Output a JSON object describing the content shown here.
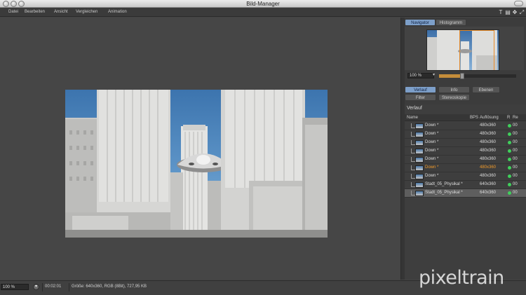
{
  "window": {
    "title": "Bild-Manager"
  },
  "menu": [
    "Datei",
    "Bearbeiten",
    "Ansicht",
    "Vergleichen",
    "Animation"
  ],
  "toolbar_icons": [
    "text-icon",
    "layout-icon",
    "move-icon",
    "expand-icon"
  ],
  "navigator": {
    "tabs": [
      "Navigator",
      "Histogramm"
    ],
    "zoom": "100 %",
    "zoom_fraction": 0.3
  },
  "panel_tabs": {
    "row1": [
      "Verlauf",
      "Info",
      "Ebenen"
    ],
    "row2": [
      "Filter",
      "Stereoskopie"
    ]
  },
  "history": {
    "section_title": "Verlauf",
    "columns": {
      "name": "Name",
      "bps": "BPS",
      "resolution": "Auflösung",
      "r": "R",
      "re": "Re"
    },
    "rows": [
      {
        "name": "Down *",
        "res": "480x360",
        "extra": "00"
      },
      {
        "name": "Down *",
        "res": "480x360",
        "extra": "00"
      },
      {
        "name": "Down *",
        "res": "480x360",
        "extra": "00"
      },
      {
        "name": "Down *",
        "res": "480x360",
        "extra": "00"
      },
      {
        "name": "Down *",
        "res": "480x360",
        "extra": "00"
      },
      {
        "name": "Down *",
        "res": "480x360",
        "extra": "00"
      },
      {
        "name": "Down *",
        "res": "480x360",
        "extra": "00"
      },
      {
        "name": "Stadt_05_Physikal *",
        "res": "640x360",
        "extra": "00"
      },
      {
        "name": "Stadt_05_Physikal *",
        "res": "640x360",
        "extra": "00"
      }
    ]
  },
  "status": {
    "zoom": "100 %",
    "time": "00:02:01",
    "info": "Größe: 640x360, RGB (8Bit), 727,95 KB"
  },
  "watermark": "pixeltrain",
  "colors": {
    "accent": "#7d9fc9",
    "highlight": "#f09a2a",
    "status_dot": "#3fd15b"
  }
}
